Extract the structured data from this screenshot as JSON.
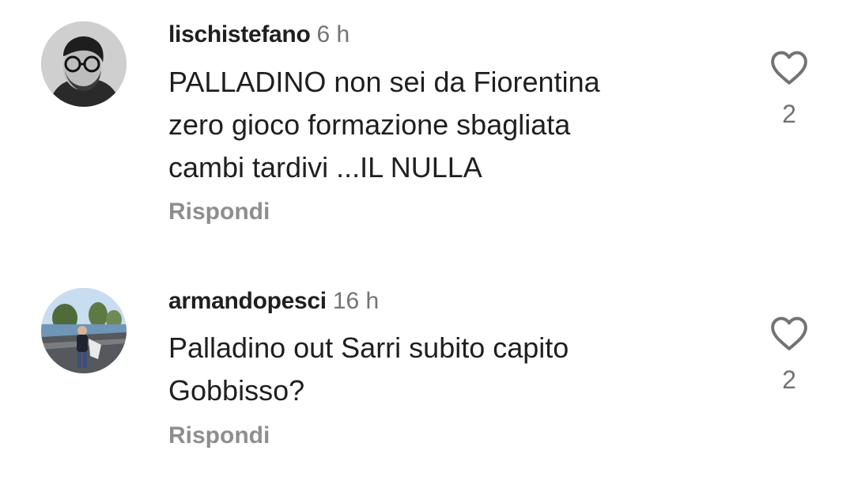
{
  "comments": [
    {
      "username": "lischistefano",
      "time": "6 h",
      "text_lines": [
        "PALLADINO non sei da Fiorentina",
        "zero gioco formazione sbagliata",
        "cambi tardivi ...IL NULLA"
      ],
      "reply_label": "Rispondi",
      "likes": "2",
      "avatar_icon": "avatar-man-glasses",
      "like_icon": "heart-outline-icon"
    },
    {
      "username": "armandopesci",
      "time": "16 h",
      "text_lines": [
        "Palladino out Sarri subito capito",
        "Gobbisso?"
      ],
      "reply_label": "Rispondi",
      "likes": "2",
      "avatar_icon": "avatar-lakeside-photo",
      "like_icon": "heart-outline-icon"
    }
  ],
  "colors": {
    "text": "#1f1f1f",
    "secondary": "#737373",
    "reply": "#8e8e8e",
    "background": "#ffffff"
  }
}
